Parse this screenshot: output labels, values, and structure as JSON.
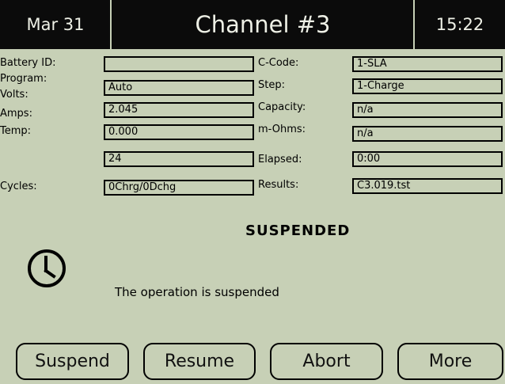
{
  "header": {
    "date": "Mar 31",
    "title": "Channel #3",
    "time": "15:22"
  },
  "fields_left": [
    {
      "label": "Battery ID:",
      "value": ""
    },
    {
      "label": "Program:",
      "value": "Auto"
    },
    {
      "label": "Volts:",
      "value": "2.045"
    },
    {
      "label": "Amps:",
      "value": "0.000"
    },
    {
      "label": "Temp:",
      "value": "24"
    },
    {
      "label": "Cycles:",
      "value": "0Chrg/0Dchg"
    }
  ],
  "fields_right": [
    {
      "label": "C-Code:",
      "value": "1-SLA"
    },
    {
      "label": "Step:",
      "value": "1-Charge"
    },
    {
      "label": "Capacity:",
      "value": "n/a"
    },
    {
      "label": "m-Ohms:",
      "value": "n/a"
    },
    {
      "label": "Elapsed:",
      "value": "0:00"
    },
    {
      "label": "Results:",
      "value": "C3.019.tst"
    }
  ],
  "status": {
    "title": "SUSPENDED",
    "message": "The operation is suspended",
    "icon": "clock-icon"
  },
  "buttons": {
    "suspend": "Suspend",
    "resume": "Resume",
    "abort": "Abort",
    "more": "More"
  },
  "colors": {
    "background": "#c7d0b6",
    "header": "#0b0b0b",
    "header_text": "#eef0e6",
    "ink": "#000000"
  }
}
